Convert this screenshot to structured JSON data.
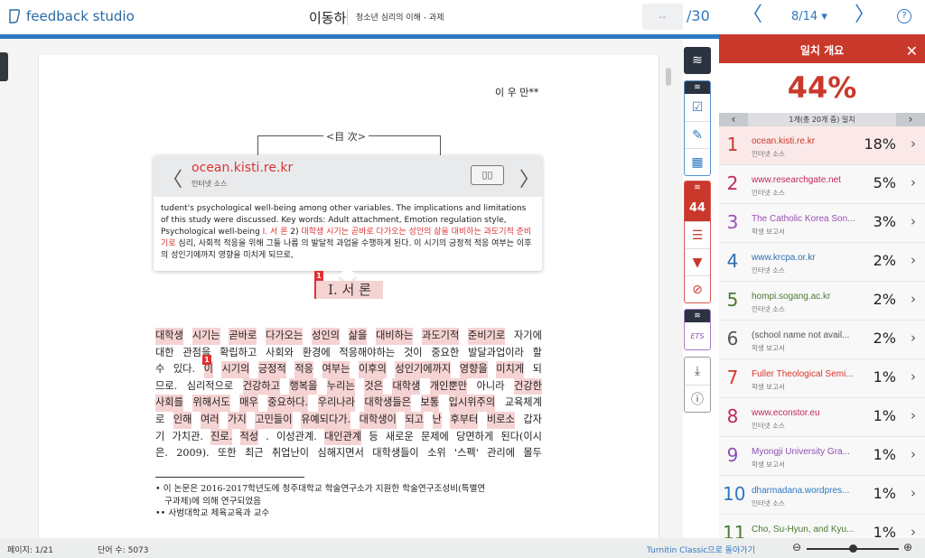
{
  "header": {
    "app_name": "feedback studio",
    "student": "이동하",
    "assignment": "청소년 심리의 이해 - 과제",
    "grade_placeholder": "--",
    "grade_out_of": "/30",
    "page_indicator": "8/14 ▾",
    "prev": "〈",
    "next": "〉",
    "help": "?"
  },
  "colors": {
    "brand_blue": "#2e78c2",
    "match_red": "#c9392b",
    "highlight": "#f6d3d3"
  },
  "document": {
    "author": "이 우 만**",
    "toc_label": "<目 次>",
    "section_title": "Ⅰ. 서 론",
    "badge": "1",
    "lines": [
      [
        {
          "t": "대학생 시기는 곧바로 다가오는 성인의 삶을 대비하는 과도기적 준비기로",
          "hl": true
        },
        {
          "t": "자기에",
          "hl": false
        }
      ],
      [
        {
          "t": "대한 관점을 확립하고 사회와 환경에 적응해야하는 것이 중요한 발달과업이라 할",
          "hl": false
        }
      ],
      [
        {
          "t": "수 있다.",
          "hl": false
        },
        {
          "t": "이 시기의 긍정적 적응 여부는 이후의 성인기에까지 영향을 미치게",
          "hl": true
        },
        {
          "t": "되",
          "hl": false
        }
      ],
      [
        {
          "t": "므로. 심리적으로",
          "hl": false
        },
        {
          "t": "건강하고 행복을 누리는 것은 대학생 개인뿐만",
          "hl": true
        },
        {
          "t": "아니라",
          "hl": false
        },
        {
          "t": "건강한",
          "hl": true
        }
      ],
      [
        {
          "t": "사회를 위해서도 매우 중요하다. 우리나라 대학생들은 보통 입시위주의",
          "hl": true
        },
        {
          "t": "교육체계",
          "hl": false
        }
      ],
      [
        {
          "t": "로",
          "hl": false
        },
        {
          "t": "인해 여러 가지 고민들이 유예되다가. 대학생이 되고 난 후부터 비로소",
          "hl": true
        },
        {
          "t": "갑자",
          "hl": false
        }
      ],
      [
        {
          "t": "기 가치관.",
          "hl": false
        },
        {
          "t": "진로. 적성",
          "hl": true
        },
        {
          "t": ". 이성관계.",
          "hl": false
        },
        {
          "t": "대인관계",
          "hl": true
        },
        {
          "t": "등 새로운 문제에 당면하게 된다(이시",
          "hl": false
        }
      ],
      [
        {
          "t": "은. 2009). 또한 최근 취업난이 심해지면서 대학생들이 소위 '스펙' 관리에 몰두",
          "hl": false
        }
      ]
    ],
    "footnotes": [
      "• 이 논문은 2016-2017학년도에 청주대학교 학술연구소가 지원한 학술연구조성비(특별연",
      "  구과제)에 의해 연구되었음",
      "•• 사범대학교 체육교육과 교수"
    ]
  },
  "popup": {
    "source": "ocean.kisti.re.kr",
    "type": "인터넷 소스",
    "compare_icon": "▯▯",
    "text_plain": "tudent's psychological well-being among other variables. The implications and limitations of this study were discussed. Key words: Adult attachment, Emotion regulation style, Psychological well-being ",
    "text_red1": "Ⅰ. 서 론",
    "text_mid": " 2) ",
    "text_red2": "대학생 시기는 곧바로 다가오는 성인의 삶을 대비하는 과도기적 준비기로",
    "text_end": " 심리, 사회적 적응을 위해 그들 나름 의 발달적 과업을 수행하게 된다. 이 시기의 긍정적 적응 여부는 이후의 성인기에까지 영향을 미치게 되므로,"
  },
  "toolbar": {
    "similarity_score": "44"
  },
  "panel": {
    "title": "일치 개요",
    "close": "✕",
    "overall": "44%",
    "nav_text": "1개(총 20개 중) 일치",
    "matches": [
      {
        "n": "1",
        "source": "ocean.kisti.re.kr",
        "type": "인터넷 소스",
        "pct": "18%",
        "color": "#c9392b"
      },
      {
        "n": "2",
        "source": "www.researchgate.net",
        "type": "인터넷 소스",
        "pct": "5%",
        "color": "#c2285a"
      },
      {
        "n": "3",
        "source": "The Catholic Korea Son...",
        "type": "학생 보고서",
        "pct": "3%",
        "color": "#9b4fb5"
      },
      {
        "n": "4",
        "source": "www.krcpa.or.kr",
        "type": "인터넷 소스",
        "pct": "2%",
        "color": "#2e6fae"
      },
      {
        "n": "5",
        "source": "hompi.sogang.ac.kr",
        "type": "인터넷 소스",
        "pct": "2%",
        "color": "#4b7a33"
      },
      {
        "n": "6",
        "source": "(school name not avail...",
        "type": "학생 보고서",
        "pct": "2%",
        "color": "#555555"
      },
      {
        "n": "7",
        "source": "Fuller Theological Semi...",
        "type": "학생 보고서",
        "pct": "1%",
        "color": "#d9362b"
      },
      {
        "n": "8",
        "source": "www.econstor.eu",
        "type": "인터넷 소스",
        "pct": "1%",
        "color": "#c2285a"
      },
      {
        "n": "9",
        "source": "Myongji University Gra...",
        "type": "학생 보고서",
        "pct": "1%",
        "color": "#8e4fb5"
      },
      {
        "n": "10",
        "source": "dharmadana.wordpres...",
        "type": "인터넷 소스",
        "pct": "1%",
        "color": "#2e78c2"
      },
      {
        "n": "11",
        "source": "Cho, Su-Hyun, and Kyu...",
        "type": "",
        "pct": "1%",
        "color": "#4b7a33"
      }
    ]
  },
  "footer": {
    "page": "페이지: 1/21",
    "words": "단어 수: 5073",
    "classic_link": "Turnitin Classic으로 돌아가기",
    "zoom_level": 0.5
  }
}
